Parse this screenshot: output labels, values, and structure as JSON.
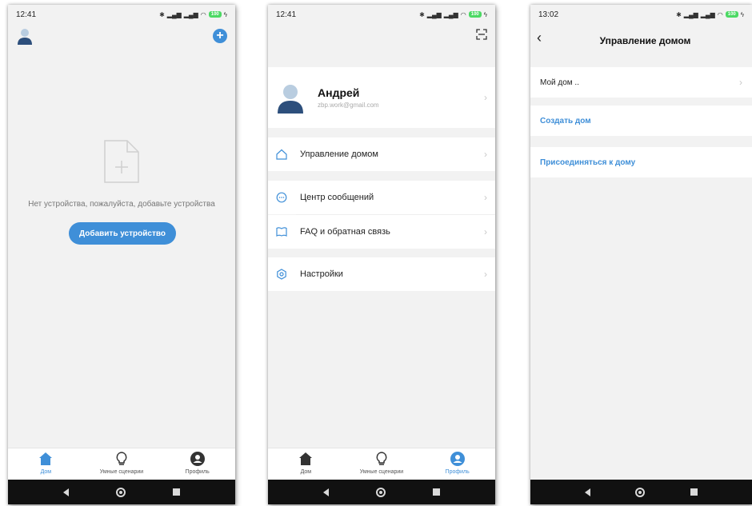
{
  "screens": {
    "home": {
      "time": "12:41",
      "battery": "100",
      "empty_text": "Нет устройства, пожалуйста, добавьте устройства",
      "add_device_label": "Добавить устройство",
      "tabs": [
        {
          "label": "Дом",
          "icon": "home-icon"
        },
        {
          "label": "Умные сценарии",
          "icon": "lightbulb-icon"
        },
        {
          "label": "Профиль",
          "icon": "profile-icon"
        }
      ],
      "active_tab": "Дом"
    },
    "profile": {
      "time": "12:41",
      "battery": "100",
      "user_name": "Андрей",
      "user_email": "zbp.work@gmail.com",
      "menu": [
        {
          "label": "Управление домом",
          "icon": "house-outline-icon"
        },
        {
          "label": "Центр сообщений",
          "icon": "message-icon"
        },
        {
          "label": "FAQ и обратная связь",
          "icon": "book-icon"
        },
        {
          "label": "Настройки",
          "icon": "settings-icon"
        }
      ],
      "tabs": [
        {
          "label": "Дом",
          "icon": "home-icon"
        },
        {
          "label": "Умные сценарии",
          "icon": "lightbulb-icon"
        },
        {
          "label": "Профиль",
          "icon": "profile-icon"
        }
      ],
      "active_tab": "Профиль"
    },
    "home_management": {
      "time": "13:02",
      "battery": "100",
      "title": "Управление домом",
      "home_item": "Мой дом ..",
      "create_home": "Создать дом",
      "join_home": "Присоединяться к дому"
    }
  },
  "colors": {
    "accent": "#3f8fd8",
    "background": "#f2f2f2",
    "navbar": "#111111"
  }
}
